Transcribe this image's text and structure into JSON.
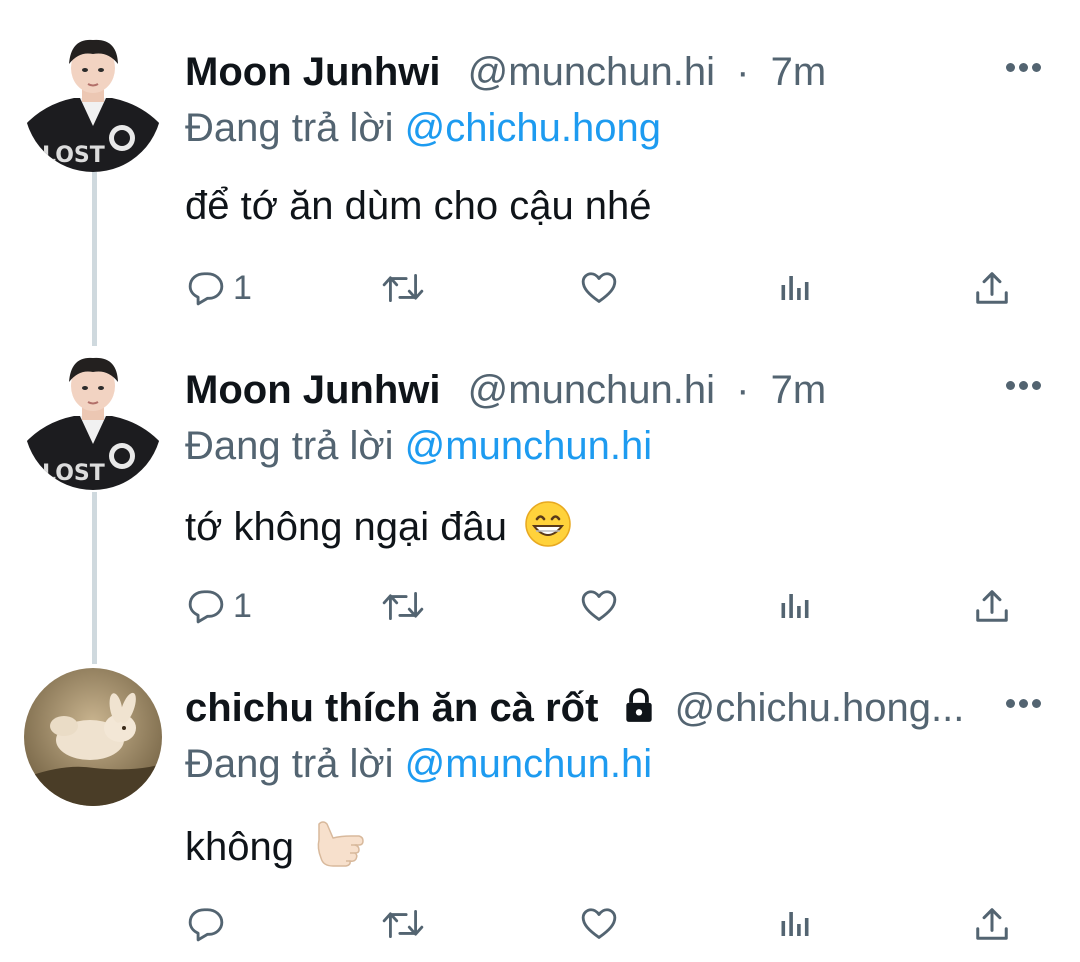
{
  "tweets": [
    {
      "display_name": "Moon Junhwi",
      "handle": "@munchun.hi",
      "separator": "·",
      "time": "7m",
      "reply_prefix": "Đang trả lời",
      "reply_to": "@chichu.hong",
      "text": "để tớ ăn dùm cho cậu nhé",
      "emoji": "",
      "reply_count": "1",
      "protected": false
    },
    {
      "display_name": "Moon Junhwi",
      "handle": "@munchun.hi",
      "separator": "·",
      "time": "7m",
      "reply_prefix": "Đang trả lời",
      "reply_to": "@munchun.hi",
      "text": "tớ không ngại đâu",
      "emoji": "grinning-face",
      "reply_count": "1",
      "protected": false
    },
    {
      "display_name": "chichu thích ăn cà rốt",
      "handle": "@chichu.hong...",
      "separator": "",
      "time": "",
      "reply_prefix": "Đang trả lời",
      "reply_to": "@munchun.hi",
      "text": "không",
      "emoji": "call-me-hand",
      "reply_count": "",
      "protected": true
    }
  ],
  "icons": {
    "reply": "reply-icon",
    "retweet": "retweet-icon",
    "like": "like-icon",
    "views": "views-icon",
    "share": "share-icon",
    "more": "more-icon",
    "lock": "lock-icon"
  },
  "colors": {
    "text": "#0f1419",
    "secondary": "#536471",
    "link": "#1d9bf0",
    "thread_line": "#cfd9de"
  }
}
